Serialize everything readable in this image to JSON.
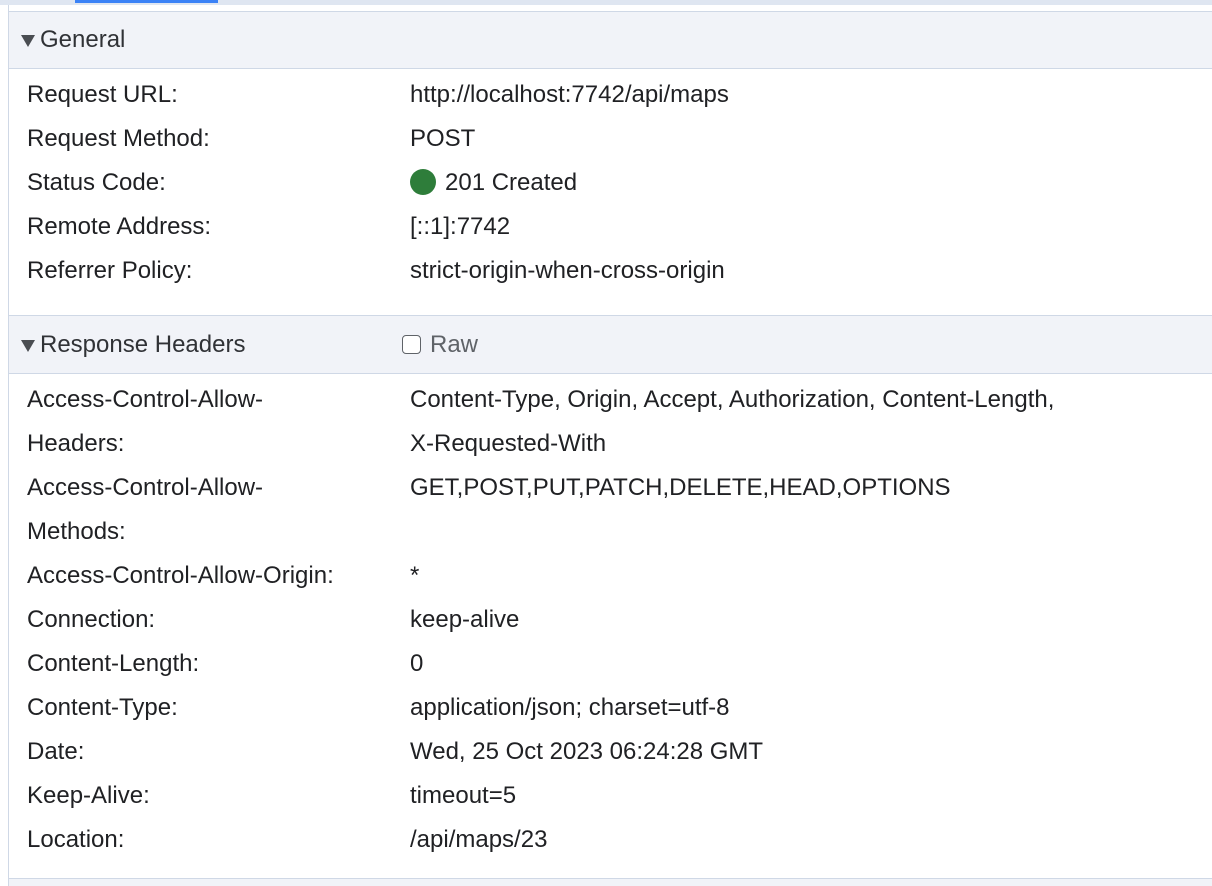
{
  "colors": {
    "status_ok": "#2e7d3a",
    "tab_accent": "#3b82f6"
  },
  "general": {
    "title": "General",
    "rows": [
      {
        "key": "Request URL:",
        "value": "http://localhost:7742/api/maps"
      },
      {
        "key": "Request Method:",
        "value": "POST"
      },
      {
        "key": "Status Code:",
        "value": "201 Created"
      },
      {
        "key": "Remote Address:",
        "value": "[::1]:7742"
      },
      {
        "key": "Referrer Policy:",
        "value": "strict-origin-when-cross-origin"
      }
    ]
  },
  "response_headers": {
    "title": "Response Headers",
    "raw_label": "Raw",
    "raw_checked": false,
    "rows": [
      {
        "key_line1": "Access-Control-Allow-",
        "key_line2": "Headers:",
        "value_line1": "Content-Type, Origin, Accept, Authorization, Content-Length,",
        "value_line2": "X-Requested-With"
      },
      {
        "key_line1": "Access-Control-Allow-",
        "key_line2": "Methods:",
        "value_line1": "GET,POST,PUT,PATCH,DELETE,HEAD,OPTIONS"
      },
      {
        "key": "Access-Control-Allow-Origin:",
        "value": "*"
      },
      {
        "key": "Connection:",
        "value": "keep-alive"
      },
      {
        "key": "Content-Length:",
        "value": "0"
      },
      {
        "key": "Content-Type:",
        "value": "application/json; charset=utf-8"
      },
      {
        "key": "Date:",
        "value": "Wed, 25 Oct 2023 06:24:28 GMT"
      },
      {
        "key": "Keep-Alive:",
        "value": "timeout=5"
      },
      {
        "key": "Location:",
        "value": "/api/maps/23"
      }
    ]
  }
}
